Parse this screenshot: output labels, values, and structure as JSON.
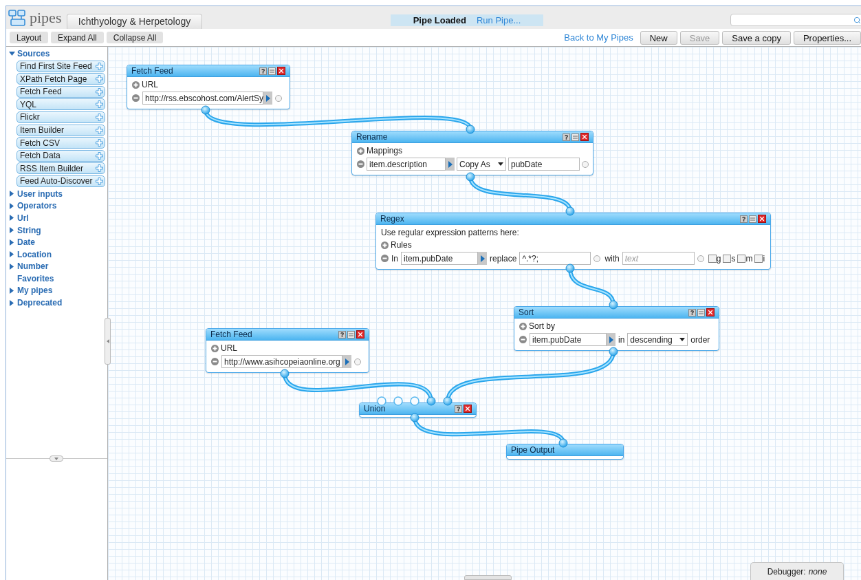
{
  "header": {
    "logo": "pipes",
    "tab": {
      "label": "Ichthyology & Herpetology",
      "selected": true
    },
    "status": "Pipe Loaded",
    "run_link": "Run Pipe..."
  },
  "toolbar": [
    {
      "label": "Layout"
    },
    {
      "label": "Expand All"
    },
    {
      "label": "Collapse All"
    }
  ],
  "nav_link": "Back to My Pipes",
  "actions": [
    {
      "label": "New",
      "disabled": false
    },
    {
      "label": "Save",
      "disabled": true
    },
    {
      "label": "Save a copy",
      "disabled": false
    },
    {
      "label": "Properties...",
      "disabled": false
    }
  ],
  "library": [
    {
      "kind": "folder",
      "label": "Sources",
      "expanded": true,
      "items": [
        "Find First Site Feed",
        "XPath Fetch Page",
        "Fetch Feed",
        "YQL",
        "Flickr",
        "Item Builder",
        "Fetch CSV",
        "Fetch Data",
        "RSS Item Builder",
        "Feed Auto-Discover"
      ]
    },
    {
      "kind": "folder",
      "label": "User inputs",
      "expanded": false
    },
    {
      "kind": "folder",
      "label": "Operators",
      "expanded": false
    },
    {
      "kind": "folder",
      "label": "Url",
      "expanded": false
    },
    {
      "kind": "folder",
      "label": "String",
      "expanded": false
    },
    {
      "kind": "folder",
      "label": "Date",
      "expanded": false
    },
    {
      "kind": "folder",
      "label": "Location",
      "expanded": false
    },
    {
      "kind": "folder",
      "label": "Number",
      "expanded": false
    },
    {
      "kind": "plain",
      "label": "Favorites"
    },
    {
      "kind": "folder",
      "label": "My pipes",
      "expanded": false
    },
    {
      "kind": "folder",
      "label": "Deprecated",
      "expanded": false
    }
  ],
  "modules": [
    {
      "kind": "fetch_feed",
      "title": "Fetch Feed",
      "section": "URL",
      "url": "http://rss.ebscohost.com/AlertSy"
    },
    {
      "kind": "rename",
      "title": "Rename",
      "section": "Mappings",
      "from": "item.description",
      "op": "Copy As",
      "to": "pubDate"
    },
    {
      "kind": "regex",
      "title": "Regex",
      "note": "Use regular expression patterns here:",
      "section": "Rules",
      "in_label": "In",
      "field": "item.pubDate",
      "replace_label": "replace",
      "pattern": "^.*?;",
      "with_label": "with",
      "placeholder": "text",
      "flags": [
        {
          "label": "g",
          "checked": false
        },
        {
          "label": "s",
          "checked": false
        },
        {
          "label": "m",
          "checked": false
        },
        {
          "label": "i",
          "checked": false
        }
      ]
    },
    {
      "kind": "sort",
      "title": "Sort",
      "section": "Sort by",
      "field": "item.pubDate",
      "in_label": "in",
      "order": "descending",
      "order_label": "order"
    },
    {
      "kind": "fetch_feed",
      "title": "Fetch Feed",
      "section": "URL",
      "url": "http://www.asihcopeiaonline.org"
    },
    {
      "kind": "union",
      "title": "Union"
    },
    {
      "kind": "output",
      "title": "Pipe Output"
    }
  ],
  "debugger": {
    "label": "Debugger:",
    "value": "none"
  }
}
